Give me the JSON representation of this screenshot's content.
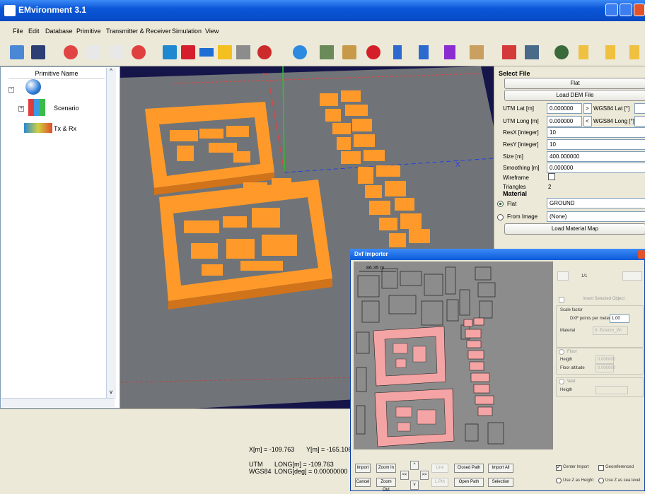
{
  "window": {
    "title": "EMvironment 3.1"
  },
  "menu": [
    "File",
    "Edit",
    "Database",
    "Primitive",
    "Transmitter & Receiver",
    "Simulation",
    "View"
  ],
  "toolbar_icons": [
    "open-icon",
    "save-icon",
    "new-icon",
    "copy-icon",
    "paste-icon",
    "delete-icon",
    "box-icon",
    "cube-icon",
    "plane-icon",
    "pyramid-icon",
    "building-icon",
    "sphere-icon",
    "antenna-icon",
    "tower-icon",
    "station-icon",
    "transmitter-icon",
    "receiver-icon",
    "receiver-array-icon",
    "grid-receiver-icon",
    "terrain-icon",
    "ray-icon",
    "scatter-icon",
    "rotate-icon",
    "axes-icon",
    "axes2-icon",
    "axes3-icon"
  ],
  "tree": {
    "header": "Primitive Name",
    "items": [
      {
        "label": "Scenario",
        "icon": "scenario-icon"
      },
      {
        "label": "Tx & Rx",
        "icon": "tx-rx-icon"
      }
    ]
  },
  "right_panel": {
    "section": "Select File",
    "flat_button": "Flat",
    "load_dem_button": "Load DEM File",
    "utm_lat_label": "UTM Lat [m]",
    "utm_lat_value": "0.000000",
    "to_wgs_button": ">",
    "wgs_lat_label": "WGS84 Lat [°]",
    "utm_long_label": "UTM Long [m]",
    "utm_long_value": "0.000000",
    "from_wgs_button": "<",
    "wgs_long_label": "WGS84 Long [°]",
    "resx_label": "ResX [integer]",
    "resx_value": "10",
    "resy_label": "ResY [integer]",
    "resy_value": "10",
    "size_label": "Size [m]",
    "size_value": "400.000000",
    "smoothing_label": "Smoothing [m]",
    "smoothing_value": "0.000000",
    "wireframe_label": "Wireframe",
    "triangles_label": "Triangles",
    "triangles_value": "2",
    "material_section": "Material",
    "flat_radio_label": "Flat",
    "material_select": "GROUND",
    "from_image_label": "From Image",
    "image_select": "(None)",
    "load_material_button": "Load Material Map"
  },
  "status": {
    "x": "X[m] = -109.763",
    "y": "Y[m] = -165.106",
    "utm_label": "UTM",
    "wgs_label": "WGS84",
    "utm_long": "LONG[m] = -109.763",
    "wgs_long": "LONG[deg] = 0.00000000"
  },
  "dxf": {
    "title": "Dxf Importer",
    "scale_text": "86.35 m",
    "page": "1/1",
    "insert_label": "Insert Selected Object",
    "scale_group": "Scale factor",
    "dxf_points_label": "DXF points per meter",
    "dxf_points_value": "1.00",
    "material_label": "Material",
    "material_value": "0: Exterior_Wi",
    "floor_label": "Floor",
    "height_label": "Heigth",
    "height_value": "0.000000",
    "floor_alt_label": "Floor altitude",
    "floor_alt_value": "0.000000",
    "wall_label": "Wall",
    "wall_height_label": "Heigth",
    "buttons": {
      "import": "Import",
      "cancel": "Cancel",
      "zoom_in": "Zoom In",
      "zoom_out": "Zoom Out",
      "up": "^",
      "down": "v",
      "left": "<<",
      "right": ">>",
      "line": "Line",
      "lpath": "L.Pth",
      "closed_path": "Closed Path",
      "open_path": "Open Path",
      "import_all": "Import All",
      "selection": "Selection"
    },
    "center_import_label": "Center Import",
    "georeferenced_label": "Georeferenced",
    "use_z_height_label": "Use Z as Height",
    "use_z_sea_label": "Use Z as sea level"
  },
  "colors": {
    "title_bar": "#0a57d8",
    "viewport_bg": "#15154a",
    "ground": "#707478",
    "building": "#ff9a2a",
    "dxf_selected": "#f4a4a4",
    "dxf_bg": "#8c8c8c"
  }
}
